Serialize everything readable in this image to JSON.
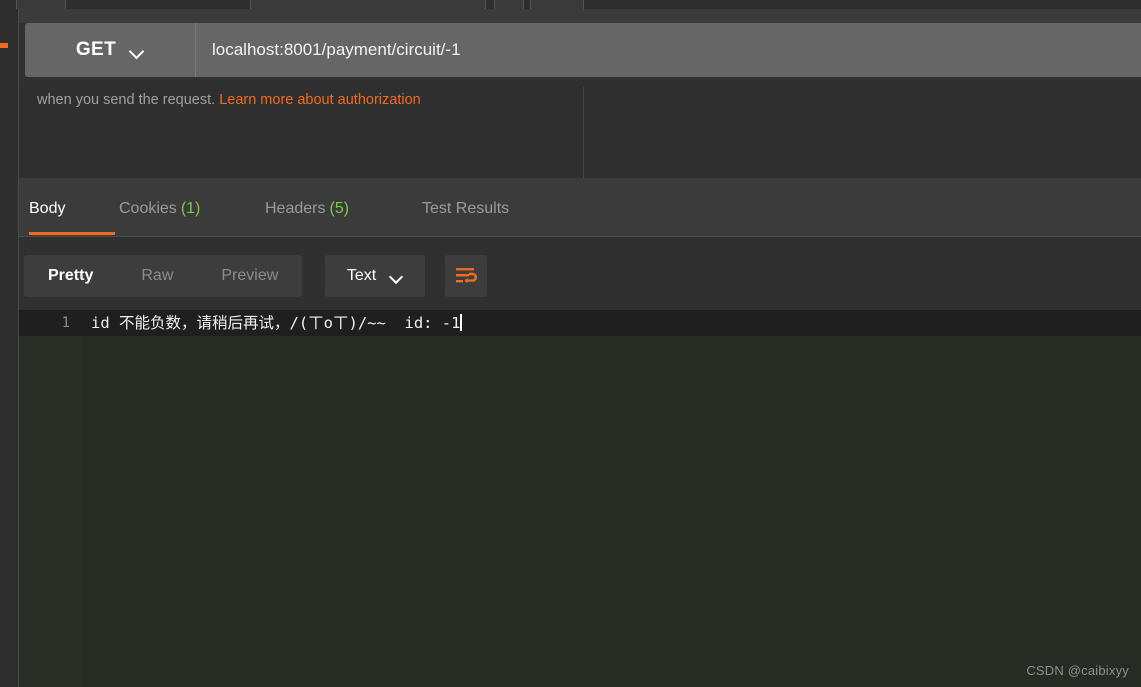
{
  "request": {
    "method": "GET",
    "method_dropdown_icon": "chevron-down-icon",
    "url": "localhost:8001/payment/circuit/-1"
  },
  "authorization_notice": {
    "text": "when you send the request.",
    "link_label": "Learn more about authorization"
  },
  "response": {
    "tabs": [
      {
        "label": "Body",
        "count": "",
        "active": true
      },
      {
        "label": "Cookies",
        "count": "(1)",
        "active": false
      },
      {
        "label": "Headers",
        "count": "(5)",
        "active": false
      },
      {
        "label": "Test Results",
        "count": "",
        "active": false
      }
    ],
    "view_modes": [
      {
        "label": "Pretty",
        "active": true
      },
      {
        "label": "Raw",
        "active": false
      },
      {
        "label": "Preview",
        "active": false
      }
    ],
    "format": {
      "label": "Text",
      "dropdown_icon": "chevron-down-icon"
    },
    "wrap_button_icon": "word-wrap-icon",
    "body": {
      "line_number": "1",
      "content": "id 不能负数，请稍后再试，/(ㄒoㄒ)/~~  id: -1"
    }
  },
  "watermark": "CSDN @caibixyy",
  "colors": {
    "accent": "#f26b21",
    "count_green": "#7ec94c",
    "editor_bg": "#282a24",
    "panel_bg": "#303030",
    "urlbar_bg": "#666666"
  }
}
